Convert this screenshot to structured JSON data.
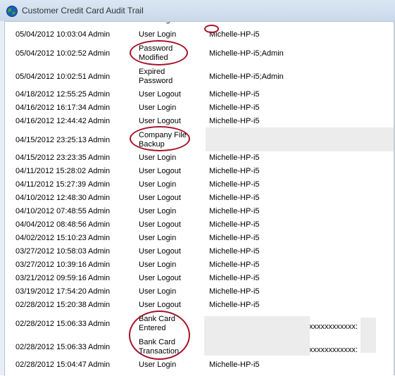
{
  "window": {
    "title": "Customer Credit Card Audit Trail"
  },
  "rows": [
    {
      "date": "05/04/2012 10:03:04",
      "user": "Admin",
      "action": [
        "User Login"
      ],
      "computer": "Michelle-HP-i5",
      "extra": ""
    },
    {
      "date": "05/04/2012 10:02:52",
      "user": "Admin",
      "action": [
        "Password",
        "Modified"
      ],
      "computer": "Michelle-HP-i5;Admin",
      "extra": ""
    },
    {
      "date": "05/04/2012 10:02:51",
      "user": "Admin",
      "action": [
        "Expired",
        "Password"
      ],
      "computer": "Michelle-HP-i5;Admin",
      "extra": ""
    },
    {
      "date": "04/18/2012 12:55:25",
      "user": "Admin",
      "action": [
        "User Logout"
      ],
      "computer": "Michelle-HP-i5",
      "extra": ""
    },
    {
      "date": "04/16/2012 16:17:34",
      "user": "Admin",
      "action": [
        "User Login"
      ],
      "computer": "Michelle-HP-i5",
      "extra": ""
    },
    {
      "date": "04/16/2012 12:44:42",
      "user": "Admin",
      "action": [
        "User Logout"
      ],
      "computer": "Michelle-HP-i5",
      "extra": ""
    },
    {
      "date": "04/15/2012 23:25:13",
      "user": "Admin",
      "action": [
        "Company File",
        "Backup"
      ],
      "computer": "",
      "extra": ""
    },
    {
      "date": "04/15/2012 23:23:35",
      "user": "Admin",
      "action": [
        "User Login"
      ],
      "computer": "Michelle-HP-i5",
      "extra": ""
    },
    {
      "date": "04/11/2012 15:28:02",
      "user": "Admin",
      "action": [
        "User Logout"
      ],
      "computer": "Michelle-HP-i5",
      "extra": ""
    },
    {
      "date": "04/11/2012 15:27:39",
      "user": "Admin",
      "action": [
        "User Login"
      ],
      "computer": "Michelle-HP-i5",
      "extra": ""
    },
    {
      "date": "04/10/2012 12:48:30",
      "user": "Admin",
      "action": [
        "User Logout"
      ],
      "computer": "Michelle-HP-i5",
      "extra": ""
    },
    {
      "date": "04/10/2012 07:48:55",
      "user": "Admin",
      "action": [
        "User Login"
      ],
      "computer": "Michelle-HP-i5",
      "extra": ""
    },
    {
      "date": "04/04/2012 08:48:56",
      "user": "Admin",
      "action": [
        "User Logout"
      ],
      "computer": "Michelle-HP-i5",
      "extra": ""
    },
    {
      "date": "04/02/2012 15:10:23",
      "user": "Admin",
      "action": [
        "User Login"
      ],
      "computer": "Michelle-HP-i5",
      "extra": ""
    },
    {
      "date": "03/27/2012 10:58:03",
      "user": "Admin",
      "action": [
        "User Logout"
      ],
      "computer": "Michelle-HP-i5",
      "extra": ""
    },
    {
      "date": "03/27/2012 10:39:16",
      "user": "Admin",
      "action": [
        "User Login"
      ],
      "computer": "Michelle-HP-i5",
      "extra": ""
    },
    {
      "date": "03/21/2012 09:59:16",
      "user": "Admin",
      "action": [
        "User Logout"
      ],
      "computer": "Michelle-HP-i5",
      "extra": ""
    },
    {
      "date": "03/19/2012 17:54:20",
      "user": "Admin",
      "action": [
        "User Login"
      ],
      "computer": "Michelle-HP-i5",
      "extra": ""
    },
    {
      "date": "02/28/2012 15:20:38",
      "user": "Admin",
      "action": [
        "User Logout"
      ],
      "computer": "Michelle-HP-i5",
      "extra": ""
    },
    {
      "date": "02/28/2012 15:06:33",
      "user": "Admin",
      "action": [
        "Bank Card",
        "Entered"
      ],
      "computer": "",
      "extra": "xxxxxxxxxxxx:"
    },
    {
      "date": "02/28/2012 15:06:33",
      "user": "Admin",
      "action": [
        "Bank Card",
        "Transaction"
      ],
      "computer": "",
      "extra": "xxxxxxxxxxxx:"
    },
    {
      "date": "02/28/2012 15:04:47",
      "user": "Admin",
      "action": [
        "User Login"
      ],
      "computer": "Michelle-HP-i5",
      "extra": ""
    }
  ],
  "annotation_color": "#a5122a",
  "icons": {
    "app": "globe-icon"
  }
}
